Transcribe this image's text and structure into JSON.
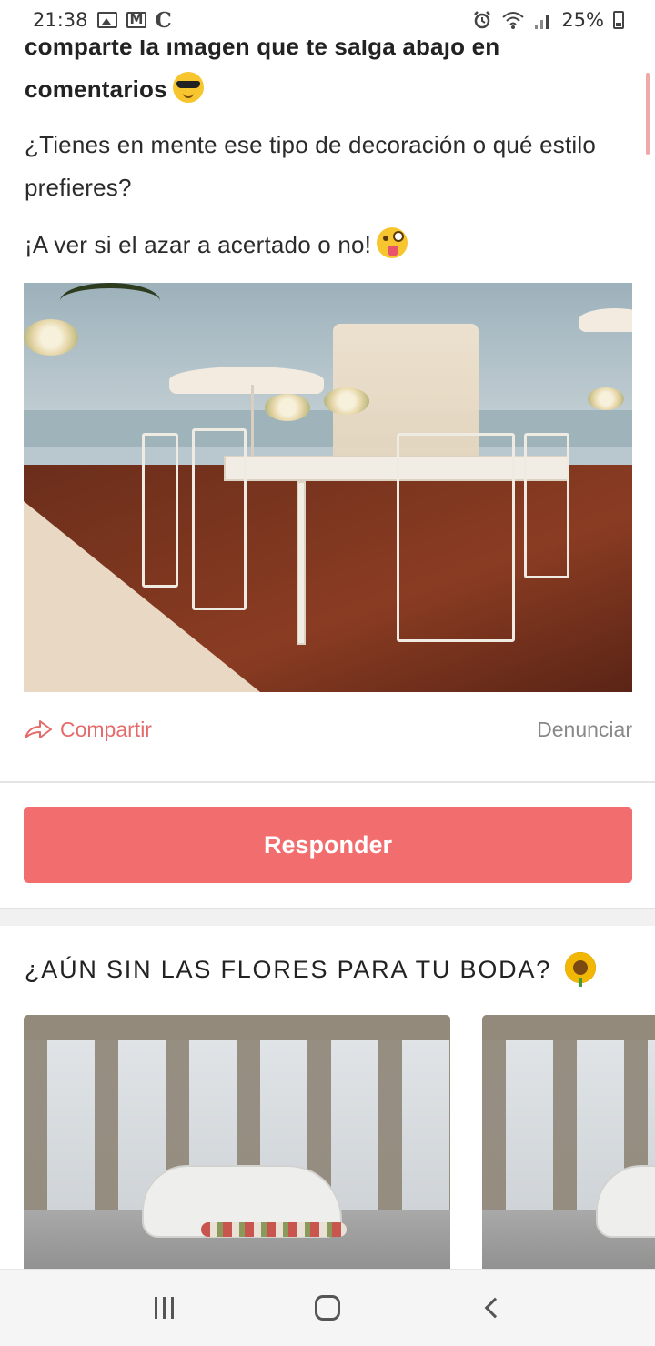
{
  "status_bar": {
    "time": "21:38",
    "battery": "25%",
    "notification_icons": [
      "gallery-icon",
      "mail-icon",
      "c-app-icon"
    ],
    "system_icons": [
      "alarm-icon",
      "wifi-icon",
      "signal-icon",
      "battery-icon"
    ]
  },
  "post": {
    "intro_bold_line1": "comparte la imagen que te salga abajo en",
    "intro_bold_line2": "comentarios",
    "question": "¿Tienes en mente ese tipo de decoración o qué estilo prefieres?",
    "closing": "¡A ver si el azar a acertado o no!",
    "image_alt": "outdoor-wedding-reception-photo"
  },
  "actions": {
    "share_label": "Compartir",
    "report_label": "Denunciar"
  },
  "reply_button_label": "Responder",
  "promo": {
    "title": "¿AÚN SIN LAS FLORES PARA TU BODA?",
    "cards": [
      {
        "image": "aqueduct-wedding-car-photo"
      },
      {
        "image": "aqueduct-wedding-car-photo"
      }
    ]
  },
  "colors": {
    "accent": "#f26d6d",
    "share_text": "#e56b6b",
    "report_text": "#888888"
  }
}
